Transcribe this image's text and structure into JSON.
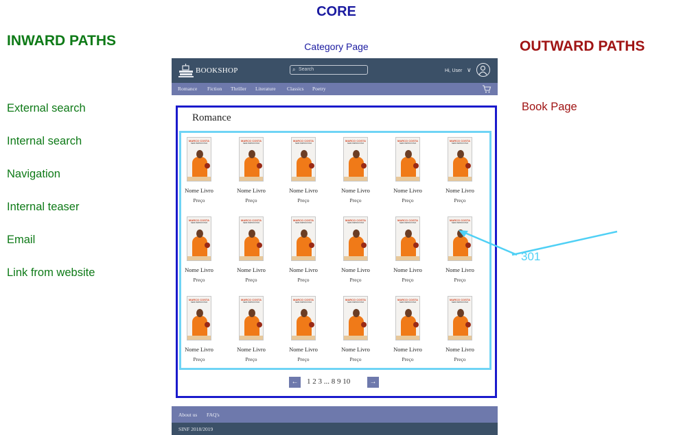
{
  "core_title": "CORE",
  "category_page_label": "Category Page",
  "inward": {
    "title": "INWARD PATHS",
    "items": [
      "External search",
      "Internal search",
      "Navigation",
      "Internal teaser",
      "Email",
      "Link from website"
    ]
  },
  "outward": {
    "title": "OUTWARD PATHS",
    "items": [
      "Book Page"
    ]
  },
  "redirect_code": "301",
  "mockup": {
    "logo": "BOOKSHOP",
    "search_placeholder": "Search",
    "user": "Hi, User",
    "nav": [
      "Romance",
      "Fiction",
      "Thriller",
      "Literature",
      "Classics",
      "Poetry"
    ],
    "heading": "Romance",
    "book": {
      "author": "MARCO COSTA",
      "cover_title": "SEM IMPROVISO",
      "name": "Nome Livro",
      "price": "Preço"
    },
    "grid_rows": 3,
    "grid_cols": 6,
    "pagination": {
      "prev": "←",
      "numbers": "1 2 3 ... 8 9 10",
      "next": "→"
    },
    "footer_links": [
      "About us",
      "FAQ's"
    ],
    "copyright": "SINF 2018/2019"
  },
  "colors": {
    "core": "#1a1aa0",
    "inward": "#0e7a17",
    "outward": "#a01414",
    "header": "#3b5067",
    "nav": "#6e79ac",
    "highlight": "#6fd4f5",
    "core_frame": "#1a1acc"
  }
}
